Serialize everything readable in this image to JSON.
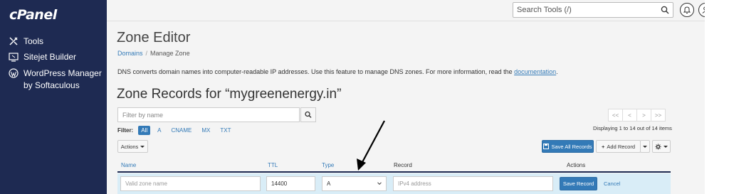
{
  "brand": {
    "logo_text": "cPanel"
  },
  "sidebar": {
    "items": [
      {
        "label": "Tools",
        "icon": "tools-icon"
      },
      {
        "label": "Sitejet Builder",
        "icon": "sitejet-icon"
      },
      {
        "label": "WordPress Manager",
        "label2": "by Softaculous",
        "icon": "wordpress-icon"
      }
    ]
  },
  "topbar": {
    "search_placeholder": "Search Tools (/)"
  },
  "page": {
    "title": "Zone Editor",
    "breadcrumb": {
      "parent": "Domains",
      "separator": "/",
      "current": "Manage Zone"
    },
    "description": "DNS converts domain names into computer-readable IP addresses. Use this feature to manage DNS zones. For more information, read the ",
    "doc_link": "documentation",
    "doc_suffix": ".",
    "section_title": "Zone Records for “mygreenenergy.in”"
  },
  "filter": {
    "placeholder": "Filter by name",
    "label": "Filter:",
    "chips": [
      "All",
      "A",
      "CNAME",
      "MX",
      "TXT"
    ],
    "active": "All"
  },
  "pagination": {
    "buttons": [
      "<<",
      "<",
      ">",
      ">>"
    ],
    "status": "Displaying 1 to 14 out of 14 items"
  },
  "toolbar": {
    "actions_label": "Actions",
    "save_all_label": "Save All Records",
    "add_record_label": "Add Record"
  },
  "table": {
    "columns": [
      "Name",
      "TTL",
      "Type",
      "Record",
      "Actions"
    ]
  },
  "edit_row": {
    "name_placeholder": "Valid zone name",
    "ttl_value": "14400",
    "type_value": "A",
    "record_placeholder": "IPv4 address",
    "save_label": "Save Record",
    "cancel_label": "Cancel"
  },
  "colors": {
    "sidebar_bg": "#1e2a52",
    "accent": "#337ab7",
    "edit_row_bg": "#d9edf7"
  }
}
